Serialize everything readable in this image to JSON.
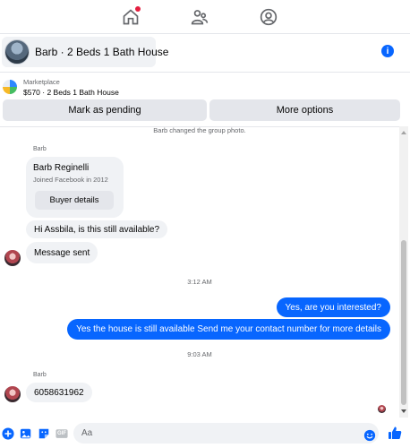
{
  "nav": {
    "icons": [
      "home-icon",
      "people-icon",
      "profile-icon"
    ],
    "home_has_notification": true
  },
  "header": {
    "title": "Barb · 2 Beds 1 Bath House"
  },
  "marketplace": {
    "label": "Marketplace",
    "detail": "$570 · 2 Beds 1 Bath House"
  },
  "actions": {
    "mark_pending": "Mark as pending",
    "more_options": "More options"
  },
  "conversation": {
    "system_message": "Barb changed the group photo.",
    "sender_name_1": "Barb",
    "profile_card": {
      "name": "Barb Reginelli",
      "subtitle": "Joined Facebook in 2012",
      "button": "Buyer details"
    },
    "incoming_1": "Hi Assbila, is this still available?",
    "incoming_2": "Message sent",
    "time_1": "3:12 AM",
    "outgoing_1": "Yes, are you interested?",
    "outgoing_2": "Yes the house is still available Send me your contact number for more details",
    "time_2": "9:03 AM",
    "sender_name_2": "Barb",
    "incoming_3": "6058631962"
  },
  "composer": {
    "placeholder": "Aa",
    "icons": [
      "plus-icon",
      "image-icon",
      "sticker-icon",
      "gif-icon",
      "emoji-icon",
      "like-icon"
    ],
    "gif_label": "GIF"
  },
  "colors": {
    "accent": "#0866ff",
    "bubble_in": "#f0f2f5",
    "button_bg": "#e4e6eb",
    "notification": "#e41e3f"
  }
}
